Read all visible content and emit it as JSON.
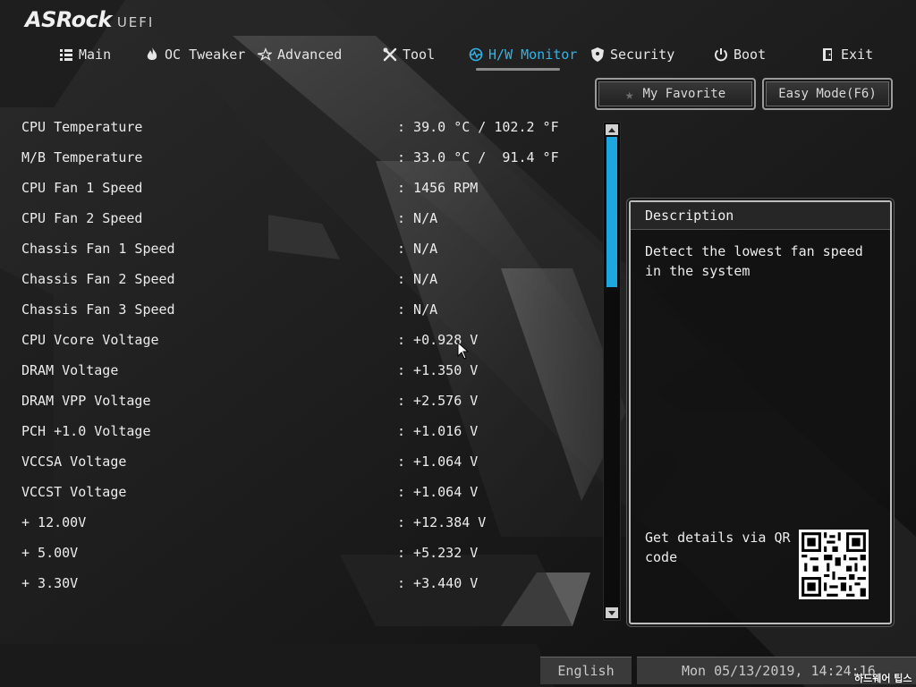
{
  "logo": {
    "brand": "ASRock",
    "suffix": "UEFI"
  },
  "nav": {
    "items": [
      {
        "label": "Main",
        "icon": "list-icon"
      },
      {
        "label": "OC Tweaker",
        "icon": "flame-icon"
      },
      {
        "label": "Advanced",
        "icon": "star-icon"
      },
      {
        "label": "Tool",
        "icon": "tools-icon"
      },
      {
        "label": "H/W Monitor",
        "icon": "monitor-icon",
        "active": true
      },
      {
        "label": "Security",
        "icon": "shield-icon"
      },
      {
        "label": "Boot",
        "icon": "power-icon"
      },
      {
        "label": "Exit",
        "icon": "exit-icon"
      }
    ]
  },
  "buttons": {
    "favorite": "My Favorite",
    "easy_mode": "Easy Mode(F6)"
  },
  "monitor": {
    "rows": [
      {
        "label": "CPU Temperature",
        "value": ": 39.0 °C / 102.2 °F"
      },
      {
        "label": "M/B Temperature",
        "value": ": 33.0 °C /  91.4 °F"
      },
      {
        "label": "CPU Fan 1 Speed",
        "value": ": 1456 RPM"
      },
      {
        "label": "CPU Fan 2 Speed",
        "value": ": N/A"
      },
      {
        "label": "Chassis Fan 1 Speed",
        "value": ": N/A"
      },
      {
        "label": "Chassis Fan 2 Speed",
        "value": ": N/A"
      },
      {
        "label": "Chassis Fan 3 Speed",
        "value": ": N/A"
      },
      {
        "label": "CPU Vcore Voltage",
        "value": ": +0.928 V"
      },
      {
        "label": "DRAM Voltage",
        "value": ": +1.350 V"
      },
      {
        "label": "DRAM VPP Voltage",
        "value": ": +2.576 V"
      },
      {
        "label": "PCH +1.0 Voltage",
        "value": ": +1.016 V"
      },
      {
        "label": "VCCSA Voltage",
        "value": ": +1.064 V"
      },
      {
        "label": "VCCST Voltage",
        "value": ": +1.064 V"
      },
      {
        "label": "+ 12.00V",
        "value": ": +12.384 V"
      },
      {
        "label": "+ 5.00V",
        "value": ": +5.232 V"
      },
      {
        "label": "+ 3.30V",
        "value": ": +3.440 V"
      }
    ]
  },
  "description": {
    "title": "Description",
    "text": "Detect the lowest fan speed in the system",
    "qr_text": "Get details via QR code"
  },
  "status": {
    "language": "English",
    "datetime": "Mon 05/13/2019, 14:24:16"
  },
  "watermark": "하드웨어 팁스",
  "colors": {
    "accent": "#2fb5ea",
    "scroll_thumb": "#1ea6e0"
  }
}
